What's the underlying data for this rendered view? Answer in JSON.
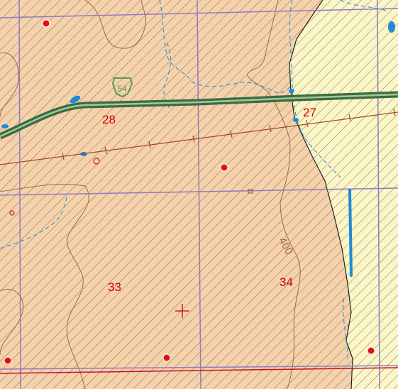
{
  "map": {
    "colors": {
      "zone_a_fill": "#f5d2aa",
      "zone_b_fill": "#fbf6c6",
      "hatch": "#6b5a55",
      "section_line": "#8f7bc0",
      "township_line": "#c8102e",
      "highway": "#3c6b40",
      "highway_edge": "#9fc99a",
      "railroad": "#a24b1b",
      "contour": "#a36a3a",
      "water": "#1f8ad6",
      "point": "#e0101a",
      "label": "#d40000",
      "shield": "#5a9a4a"
    },
    "sections": [
      {
        "id": "s28",
        "label": "28"
      },
      {
        "id": "s27",
        "label": "27"
      },
      {
        "id": "s33",
        "label": "33"
      },
      {
        "id": "s34",
        "label": "34"
      }
    ],
    "contour_label": "400",
    "route_shield": "54",
    "features": [
      "highway",
      "railroad",
      "section-lines",
      "township-line",
      "contour",
      "streams",
      "wells",
      "survey-cross"
    ]
  }
}
